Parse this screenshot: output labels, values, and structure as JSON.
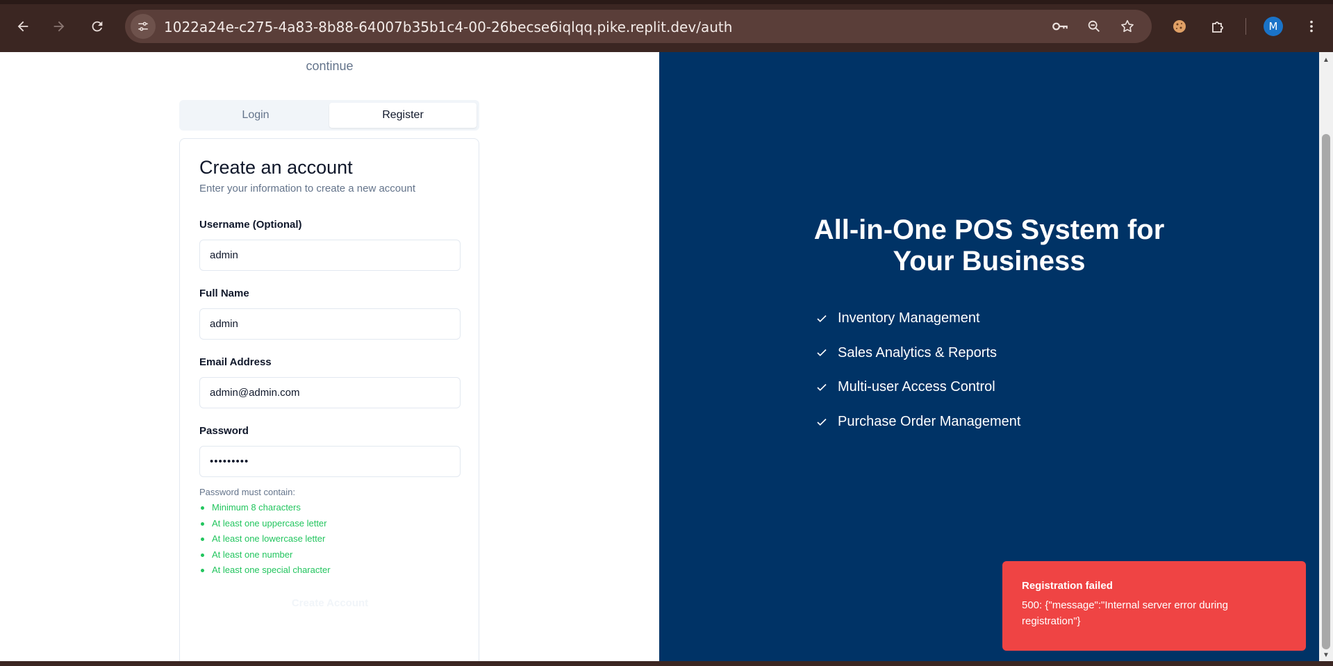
{
  "browser": {
    "url": "1022a24e-c275-4a83-8b88-64007b35b1c4-00-26becse6iqlqq.pike.replit.dev/auth",
    "profile_initial": "M"
  },
  "auth": {
    "subtitle_partial": "continue",
    "tabs": [
      {
        "label": "Login",
        "active": false
      },
      {
        "label": "Register",
        "active": true
      }
    ],
    "card": {
      "title": "Create an account",
      "description": "Enter your information to create a new account",
      "fields": {
        "username": {
          "label": "Username (Optional)",
          "value": "admin"
        },
        "full_name": {
          "label": "Full Name",
          "value": "admin"
        },
        "email": {
          "label": "Email Address",
          "value": "admin@admin.com"
        },
        "password": {
          "label": "Password",
          "value": "•••••••••"
        }
      },
      "password_rules_title": "Password must contain:",
      "password_rules": [
        "Minimum 8 characters",
        "At least one uppercase letter",
        "At least one lowercase letter",
        "At least one number",
        "At least one special character"
      ],
      "submit_label": "Create Account"
    }
  },
  "hero": {
    "title_line1": "All-in-One POS System for",
    "title_line2": "Your Business",
    "features": [
      "Inventory Management",
      "Sales Analytics & Reports",
      "Multi-user Access Control",
      "Purchase Order Management"
    ]
  },
  "toast": {
    "title": "Registration failed",
    "message": "500: {\"message\":\"Internal server error during registration\"}"
  },
  "colors": {
    "chrome_bg": "#3b2622",
    "hero_bg": "#003366",
    "toast_bg": "#ef4444",
    "rule_ok": "#22c55e"
  }
}
